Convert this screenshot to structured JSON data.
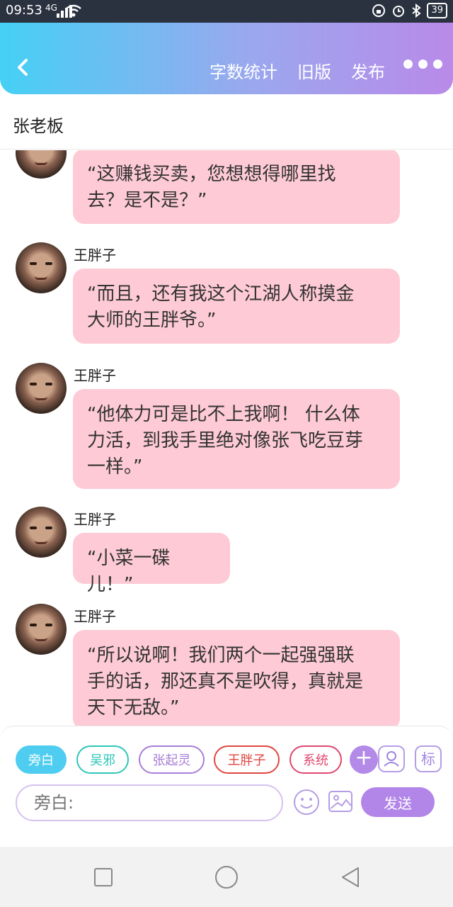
{
  "status_bar": {
    "time": "09:53",
    "network": "4G",
    "battery": "39"
  },
  "header": {
    "word_count": "字数统计",
    "old_version": "旧版",
    "publish": "发布"
  },
  "subtitle": "张老板",
  "messages": [
    {
      "speaker": "",
      "text_lines": [
        "“这赚钱买卖，您想想得哪里找",
        "去？是不是？”"
      ]
    },
    {
      "speaker": "王胖子",
      "text_lines": [
        "“而且，还有我这个江湖人称摸金",
        "大师的王胖爷。”"
      ]
    },
    {
      "speaker": "王胖子",
      "text_lines": [
        "“他体力可是比不上我啊！  什么体",
        "力活，到我手里绝对像张飞吃豆芽",
        "一样。”"
      ]
    },
    {
      "speaker": "王胖子",
      "text_lines": [
        "“小菜一碟儿！”"
      ]
    },
    {
      "speaker": "王胖子",
      "text_lines": [
        "“所以说啊！我们两个一起强强联",
        "手的话，那还真不是吹得，真就是",
        "天下无敌。”"
      ]
    }
  ],
  "role_chips": [
    {
      "label": "旁白",
      "color": "#4fcdf0"
    },
    {
      "label": "吴邪",
      "color": "#2fc6b8"
    },
    {
      "label": "张起灵",
      "color": "#a77ed8"
    },
    {
      "label": "王胖子",
      "color": "#e0463f"
    },
    {
      "label": "系统",
      "color": "#e0466f"
    }
  ],
  "tag_icon_label": "标",
  "input": {
    "placeholder": "旁白:"
  },
  "send_label": "发送",
  "colors": {
    "bubble": "#fecad6",
    "accent": "#b285e8"
  }
}
